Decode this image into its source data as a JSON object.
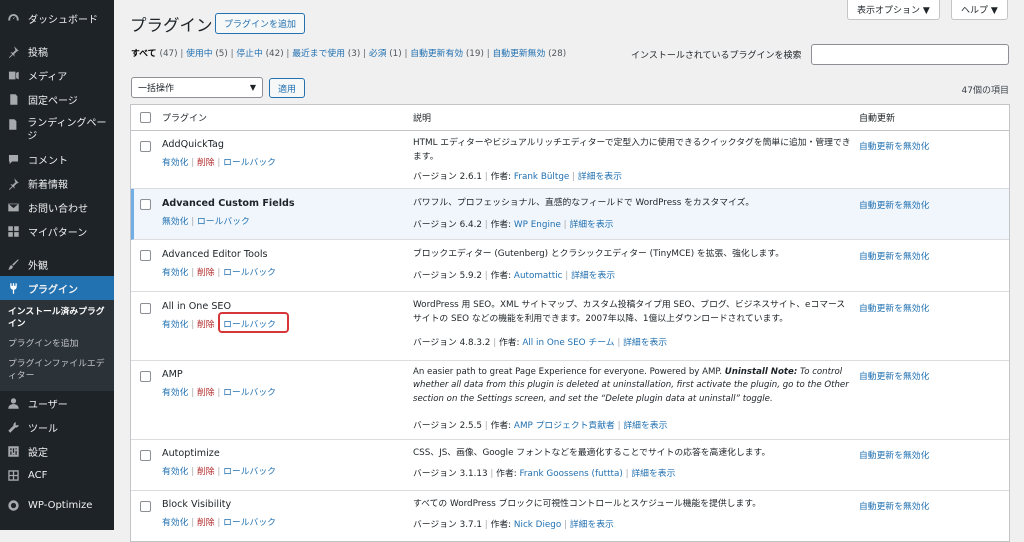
{
  "sidebar": {
    "items": [
      {
        "label": "ダッシュボード",
        "icon": "dashboard-icon"
      },
      {
        "label": "投稿",
        "icon": "pin-icon"
      },
      {
        "label": "メディア",
        "icon": "media-icon"
      },
      {
        "label": "固定ページ",
        "icon": "page-icon"
      },
      {
        "label": "ランディングページ",
        "icon": "page-icon"
      },
      {
        "label": "コメント",
        "icon": "comment-icon"
      },
      {
        "label": "新着情報",
        "icon": "pin-icon"
      },
      {
        "label": "お問い合わせ",
        "icon": "mail-icon"
      },
      {
        "label": "マイパターン",
        "icon": "grid-icon"
      },
      {
        "label": "外観",
        "icon": "brush-icon"
      },
      {
        "label": "プラグイン",
        "icon": "plugin-icon"
      },
      {
        "label": "ユーザー",
        "icon": "user-icon"
      },
      {
        "label": "ツール",
        "icon": "wrench-icon"
      },
      {
        "label": "設定",
        "icon": "settings-icon"
      },
      {
        "label": "ACF",
        "icon": "grid-icon"
      },
      {
        "label": "WP-Optimize",
        "icon": "optimize-icon"
      }
    ],
    "submenu": [
      "インストール済みプラグイン",
      "プラグインを追加",
      "プラグインファイルエディター"
    ]
  },
  "header": {
    "screen_options": "表示オプション ▼",
    "help": "ヘルプ ▼",
    "title": "プラグイン",
    "add_new": "プラグインを追加"
  },
  "views": [
    {
      "label": "すべて",
      "count": "(47)"
    },
    {
      "label": "使用中",
      "count": "(5)"
    },
    {
      "label": "停止中",
      "count": "(42)"
    },
    {
      "label": "最近まで使用",
      "count": "(3)"
    },
    {
      "label": "必須",
      "count": "(1)"
    },
    {
      "label": "自動更新有効",
      "count": "(19)"
    },
    {
      "label": "自動更新無効",
      "count": "(28)"
    }
  ],
  "search": {
    "label": "インストールされているプラグインを検索",
    "value": ""
  },
  "bulk": {
    "selected": "一括操作",
    "apply": "適用",
    "items_count": "47個の項目"
  },
  "table": {
    "headers": [
      "プラグイン",
      "説明",
      "自動更新"
    ],
    "rows": [
      {
        "name": "AddQuickTag",
        "actions": [
          "有効化",
          "削除",
          "ロールバック"
        ],
        "desc": "HTML エディターやビジュアルリッチエディターで定型入力に使用できるクイックタグを簡単に追加・管理できます。",
        "version": "バージョン 2.6.1",
        "author_label": "作者:",
        "author": "Frank Bültge",
        "details": "詳細を表示",
        "autoupdate": "自動更新を無効化"
      },
      {
        "name": "Advanced Custom Fields",
        "actions": [
          "無効化",
          "ロールバック"
        ],
        "desc": "パワフル、プロフェッショナル、直感的なフィールドで WordPress をカスタマイズ。",
        "version": "バージョン 6.4.2",
        "author_label": "作者:",
        "author": "WP Engine",
        "details": "詳細を表示",
        "autoupdate": "自動更新を無効化"
      },
      {
        "name": "Advanced Editor Tools",
        "actions": [
          "有効化",
          "削除",
          "ロールバック"
        ],
        "desc": "ブロックエディター (Gutenberg) とクラシックエディター (TinyMCE) を拡張、強化します。",
        "version": "バージョン 5.9.2",
        "author_label": "作者:",
        "author": "Automattic",
        "details": "詳細を表示",
        "autoupdate": "自動更新を無効化"
      },
      {
        "name": "All in One SEO",
        "actions": [
          "有効化",
          "削除",
          "ロールバック"
        ],
        "desc": "WordPress 用 SEO。XML サイトマップ、カスタム投稿タイプ用 SEO、ブログ、ビジネスサイト、eコマースサイトの SEO などの機能を利用できます。2007年以降、1億以上ダウンロードされています。",
        "version": "バージョン 4.8.3.2",
        "author_label": "作者:",
        "author": "All in One SEO チーム",
        "details": "詳細を表示",
        "autoupdate": "自動更新を無効化"
      },
      {
        "name": "AMP",
        "actions": [
          "有効化",
          "削除",
          "ロールバック"
        ],
        "desc_plain": "An easier path to great Page Experience for everyone. Powered by AMP. ",
        "desc_bold": "Uninstall Note:",
        "desc_italic": " To control whether all data from this plugin is deleted at uninstallation, first activate the plugin, go to the Other section on the Settings screen, and set the “Delete plugin data at uninstall” toggle.",
        "version": "バージョン 2.5.5",
        "author_label": "作者:",
        "author": "AMP プロジェクト貢献者",
        "details": "詳細を表示",
        "autoupdate": "自動更新を無効化"
      },
      {
        "name": "Autoptimize",
        "actions": [
          "有効化",
          "削除",
          "ロールバック"
        ],
        "desc": "CSS、JS、画像、Google フォントなどを最適化することでサイトの応答を高速化します。",
        "version": "バージョン 3.1.13",
        "author_label": "作者:",
        "author": "Frank Goossens (futtta)",
        "details": "詳細を表示",
        "autoupdate": "自動更新を無効化"
      },
      {
        "name": "Block Visibility",
        "actions": [
          "有効化",
          "削除",
          "ロールバック"
        ],
        "desc": "すべての WordPress ブロックに可視性コントロールとスケジュール機能を提供します。",
        "version": "バージョン 3.7.1",
        "author_label": "作者:",
        "author": "Nick Diego",
        "details": "詳細を表示",
        "autoupdate": "自動更新を無効化"
      }
    ]
  }
}
